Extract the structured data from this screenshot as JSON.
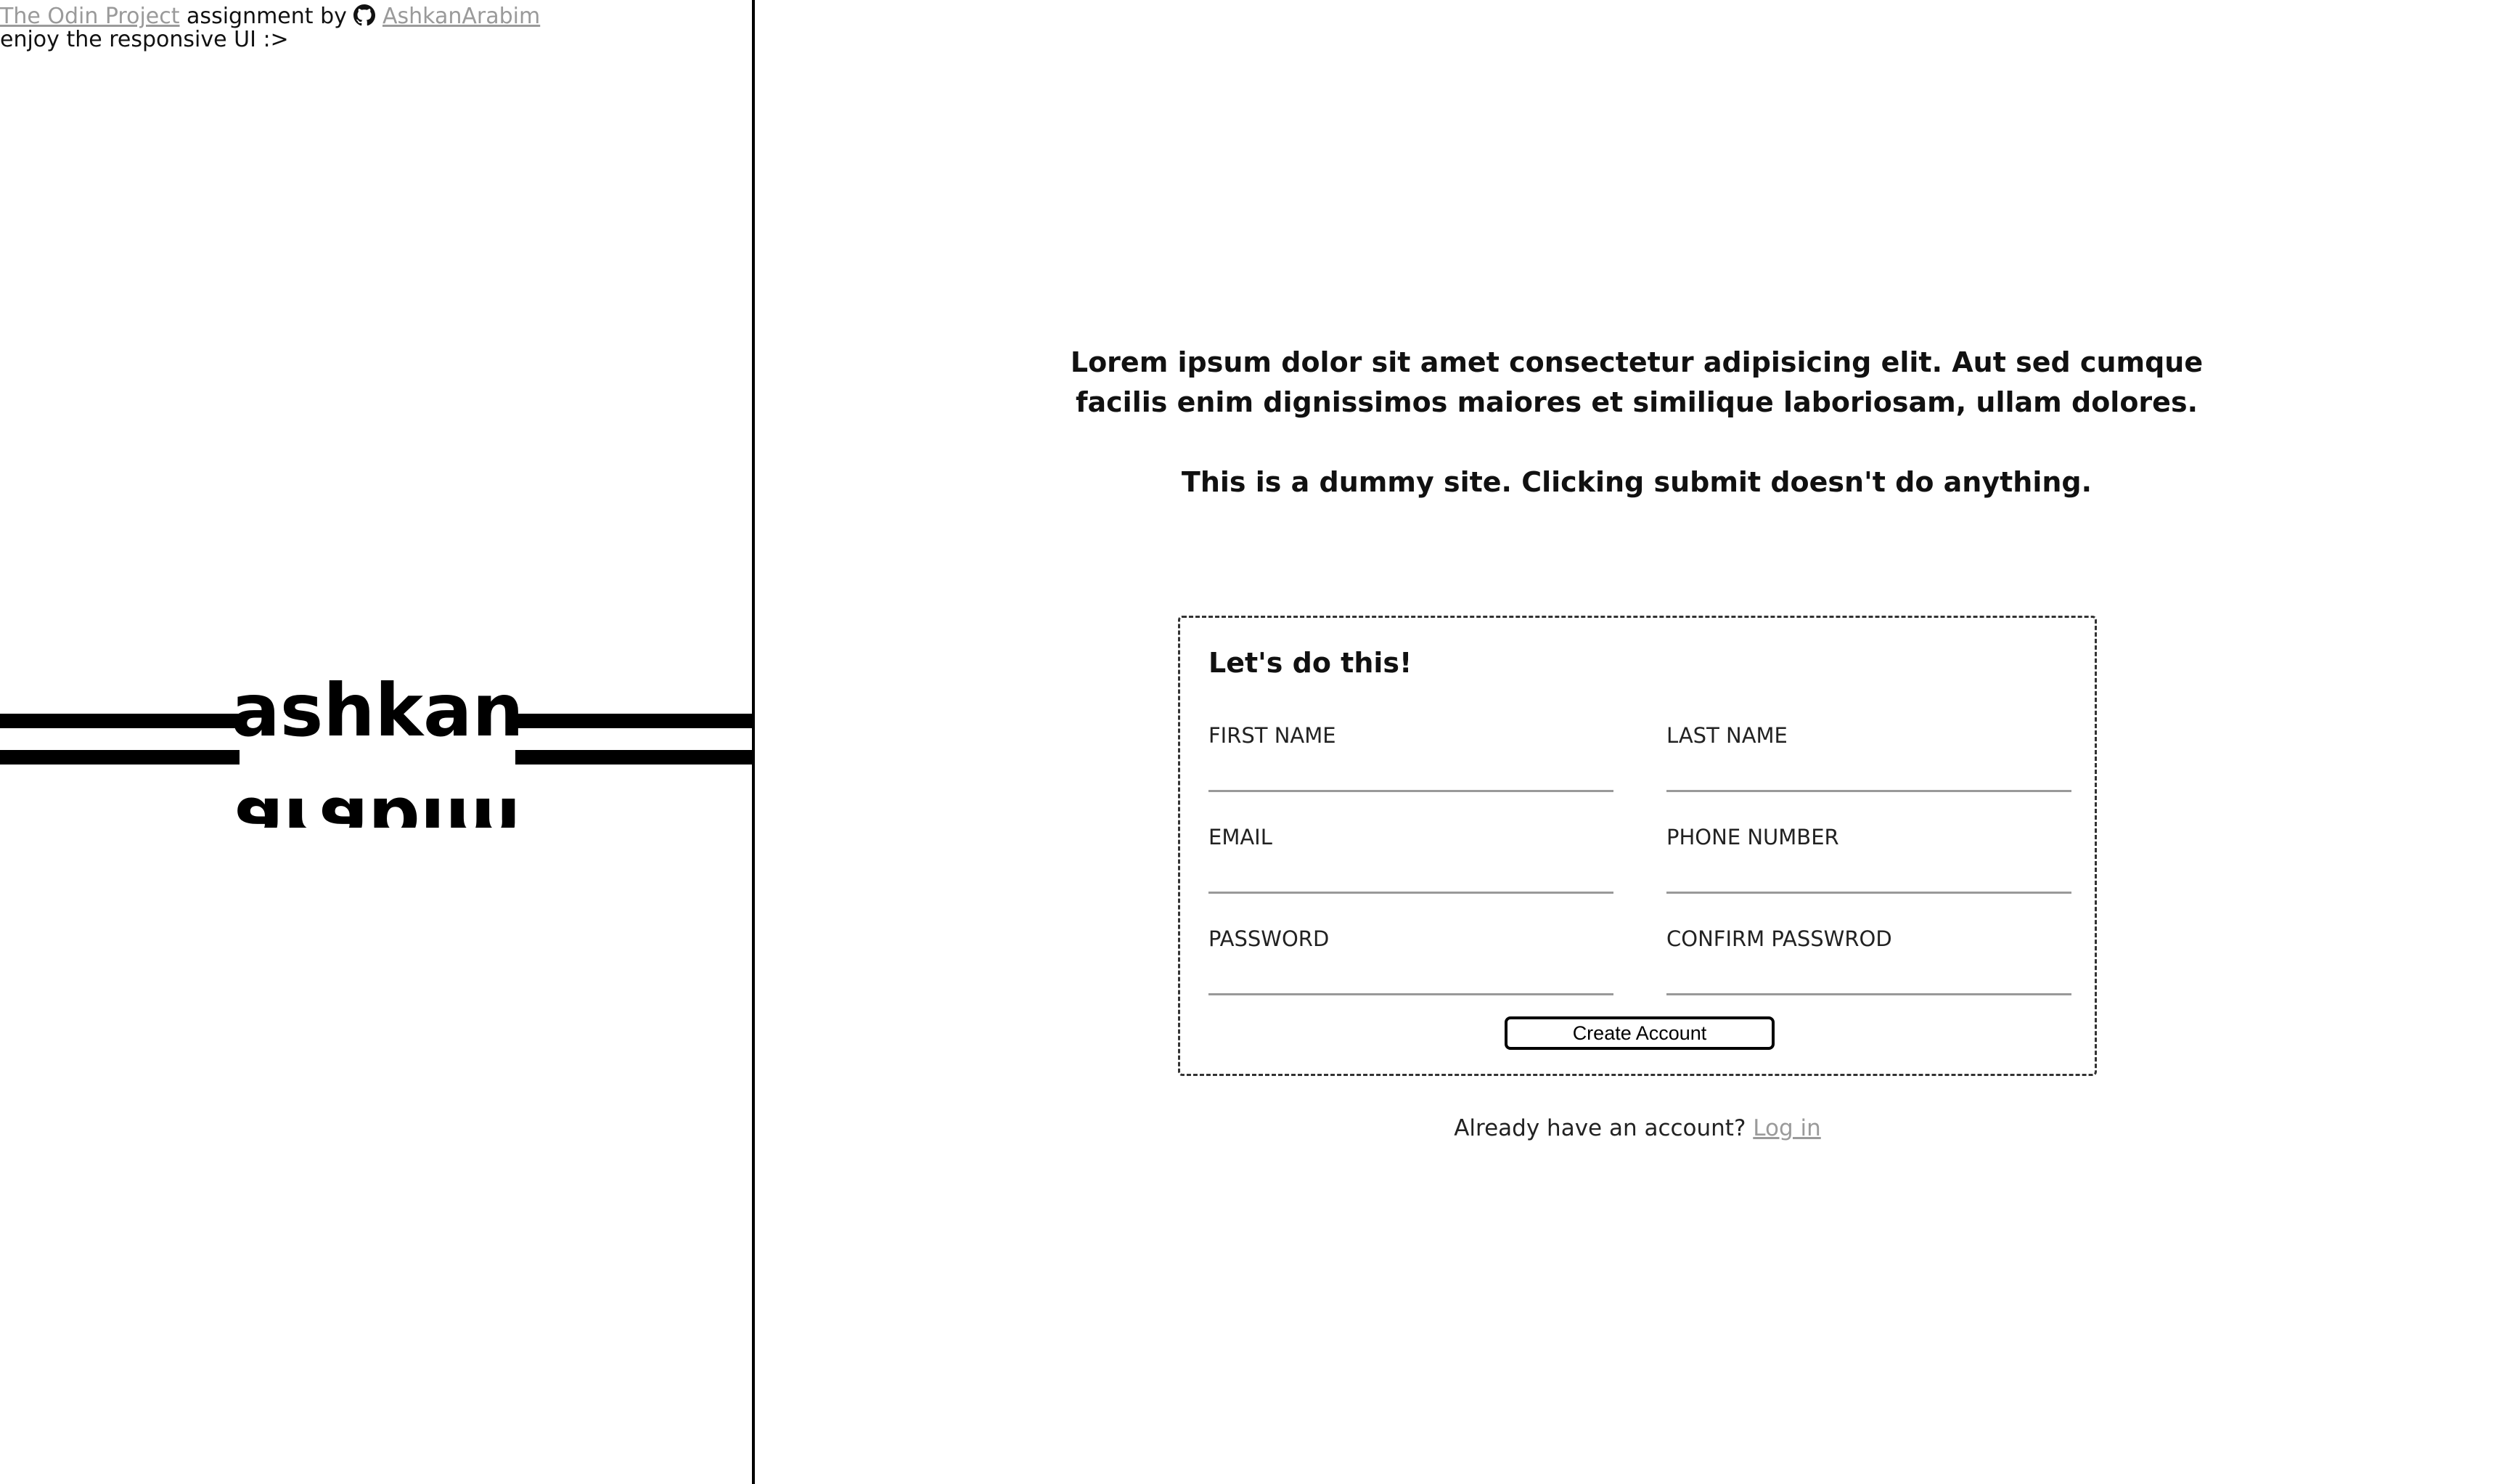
{
  "credit": {
    "odin_link": "The Odin Project",
    "middle_text": " assignment by ",
    "author_link": "AshkanArabim",
    "tagline": "enjoy the responsive UI :>"
  },
  "logo": {
    "line1": "ashkan",
    "line2": "arabim"
  },
  "intro": {
    "paragraph1": "Lorem ipsum dolor sit amet consectetur adipisicing elit. Aut sed cumque facilis enim dignissimos maiores et similique laboriosam, ullam dolores.",
    "paragraph2": "This is a dummy site. Clicking submit doesn't do anything."
  },
  "form": {
    "title": "Let's do this!",
    "fields": {
      "first_name": {
        "label": "FIRST NAME",
        "value": ""
      },
      "last_name": {
        "label": "LAST NAME",
        "value": ""
      },
      "email": {
        "label": "EMAIL",
        "value": ""
      },
      "phone": {
        "label": "PHONE NUMBER",
        "value": ""
      },
      "password": {
        "label": "PASSWORD",
        "value": ""
      },
      "confirm_password": {
        "label": "CONFIRM PASSWROD",
        "value": ""
      }
    },
    "submit_label": "Create Account"
  },
  "login": {
    "prompt": "Already have an account? ",
    "link": "Log in"
  },
  "colors": {
    "link_gray": "#9a9a9a",
    "border": "#000000",
    "input_underline": "#999999"
  },
  "icons": {
    "author": "github-icon"
  }
}
